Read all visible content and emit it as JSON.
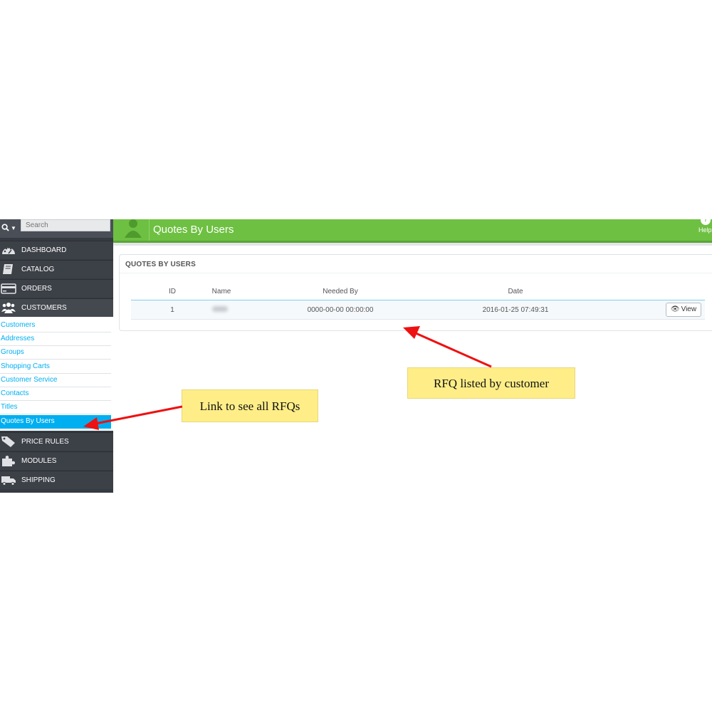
{
  "search": {
    "placeholder": "Search",
    "icon": "search-icon"
  },
  "sidebar": {
    "menu": [
      {
        "label": "DASHBOARD",
        "icon": "dashboard-icon"
      },
      {
        "label": "CATALOG",
        "icon": "book-icon"
      },
      {
        "label": "ORDERS",
        "icon": "credit-card-icon"
      },
      {
        "label": "CUSTOMERS",
        "icon": "users-icon",
        "active": true
      }
    ],
    "submenu": [
      "Customers",
      "Addresses",
      "Groups",
      "Shopping Carts",
      "Customer Service",
      "Contacts",
      "Titles",
      "Quotes By Users"
    ],
    "submenu_selected": "Quotes By Users",
    "menu_after": [
      {
        "label": "PRICE RULES",
        "icon": "tag-icon"
      },
      {
        "label": "MODULES",
        "icon": "puzzle-icon"
      },
      {
        "label": "SHIPPING",
        "icon": "truck-icon"
      }
    ]
  },
  "header": {
    "title": "Quotes By Users",
    "help_label": "Help",
    "icon": "users-icon"
  },
  "panel": {
    "heading": "QUOTES BY USERS",
    "columns": [
      "ID",
      "Name",
      "Needed By",
      "Date"
    ],
    "rows": [
      {
        "id": "1",
        "needed_by": "0000-00-00 00:00:00",
        "date": "2016-01-25 07:49:31",
        "action": "View"
      }
    ]
  },
  "callouts": {
    "rfq": "RFQ listed by customer",
    "link": "Link to see all RFQs"
  },
  "colors": {
    "header_green": "#6ec042",
    "sidebar_dark": "#363a41",
    "link_blue": "#00aff0",
    "callout_yellow": "#ffee88",
    "arrow_red": "#ee1111"
  }
}
